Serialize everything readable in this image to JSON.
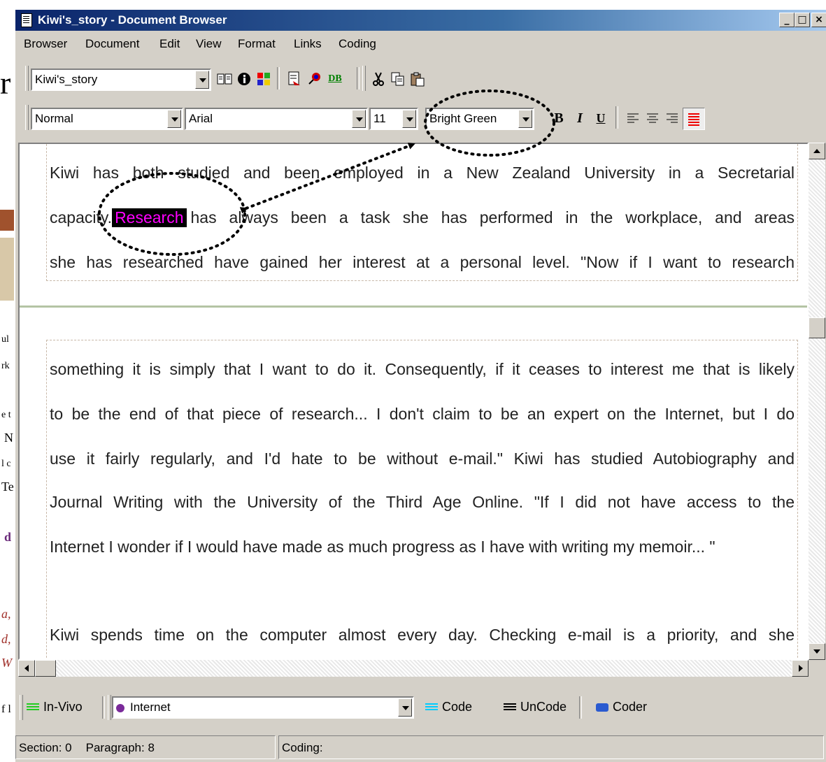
{
  "window": {
    "title": "Kiwi's_story - Document Browser"
  },
  "menu": [
    "Browser",
    "Document",
    "Edit",
    "View",
    "Format",
    "Links",
    "Coding"
  ],
  "toolbar1": {
    "document_select": "Kiwi's_story",
    "db_label": "DB"
  },
  "toolbar2": {
    "style": "Normal",
    "font": "Arial",
    "size": "11",
    "color": "Bright Green",
    "bold": "B",
    "italic": "I",
    "underline": "U"
  },
  "document": {
    "pane1_lines": [
      "Kiwi has both studied and been employed in a New Zealand University in a Secretarial",
      "has always been a task she has performed in the workplace, and areas",
      "she has researched have gained her interest at a personal level. \"Now if I want to research"
    ],
    "pane1_line2_prefix": "capacity.",
    "highlighted_word": "Research",
    "pane2_lines": [
      "something it is simply that  I want to do it. Consequently, if it ceases to interest me that is likely",
      "to be the end of that piece of research...  I don't claim to be an expert on the Internet, but I do",
      "use it fairly regularly, and I'd hate to be without e-mail.\"  Kiwi has studied Autobiography and",
      "Journal Writing with the University of the Third Age Online. \"If I did not have access to the",
      "Internet I wonder if I would have made as much progress as I have with writing my memoir... \"",
      "",
      "Kiwi spends time on the computer almost every day. Checking e-mail is a priority, and she"
    ]
  },
  "coding": {
    "invivo": "In-Vivo",
    "node": "Internet",
    "code": "Code",
    "uncode": "UnCode",
    "coder": "Coder"
  },
  "status": {
    "section": "Section: 0",
    "paragraph": "Paragraph: 8",
    "coding": "Coding:"
  },
  "background": {
    "frag_large": "r",
    "frags": [
      "ul",
      "rk",
      "e t",
      "N",
      "l c",
      "Te",
      "d",
      "a,",
      "d,",
      "W",
      "f l"
    ]
  },
  "colors": {
    "highlight_text": "#ff00ff",
    "title_start": "#0a246a",
    "annotation": "#000000"
  }
}
